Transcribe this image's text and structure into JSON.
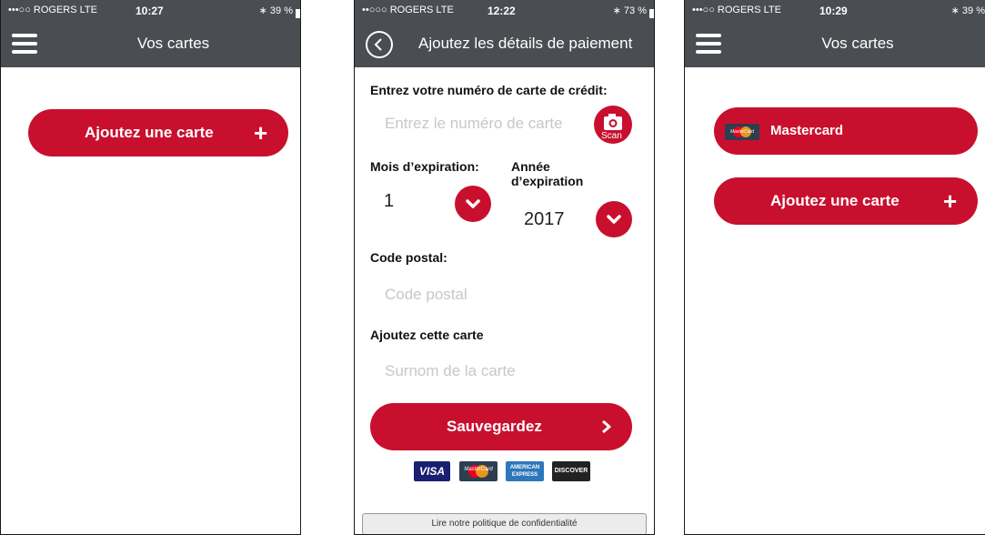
{
  "screen1": {
    "status": {
      "carrier": "•••○○ ROGERS  LTE",
      "time": "10:27",
      "battery": "39 %"
    },
    "title": "Vos cartes",
    "add_card_label": "Ajoutez une carte",
    "add_card_icon": "+"
  },
  "screen2": {
    "status": {
      "carrier": "••○○○ ROGERS  LTE",
      "time": "12:22",
      "battery": "73 %"
    },
    "title": "Ajoutez les détails de paiement",
    "card_number_label": "Entrez votre numéro de carte de crédit:",
    "card_number_placeholder": "Entrez le numéro de carte",
    "scan_label": "Scan",
    "exp_month_label": "Mois d’expiration:",
    "exp_month_value": "1",
    "exp_year_label_line1": "Année",
    "exp_year_label_line2": "d’expiration",
    "exp_year_value": "2017",
    "postal_label": "Code postal:",
    "postal_placeholder": "Code postal",
    "nickname_label": "Ajoutez cette carte",
    "nickname_placeholder": "Surnom de la carte",
    "save_label": "Sauvegardez",
    "card_brands": {
      "visa": "VISA",
      "mastercard": "MasterCard",
      "amex_line1": "AMERICAN",
      "amex_line2": "EXPRESS",
      "discover": "DISCOVER"
    },
    "privacy_label": "Lire notre politique de confidentialité"
  },
  "screen3": {
    "status": {
      "carrier": "•••○○ ROGERS  LTE",
      "time": "10:29",
      "battery": "39 %"
    },
    "title": "Vos cartes",
    "saved_card_label": "Mastercard",
    "saved_card_logo_text": "MasterCard",
    "add_card_label": "Ajoutez une carte",
    "add_card_icon": "+"
  },
  "colors": {
    "brand_red": "#c8102e",
    "nav_gray": "#4a4d52"
  }
}
